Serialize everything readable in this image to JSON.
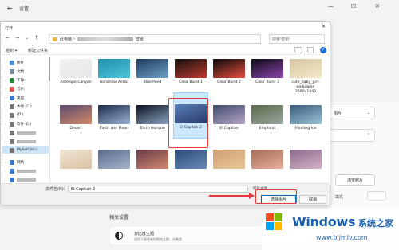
{
  "settings": {
    "back": "←",
    "title": "设置",
    "win_min": "—",
    "win_max": "☐",
    "win_close": "✕",
    "right_card1": "图片",
    "right_card2": "",
    "browse_button": "浏览照片",
    "fit_label": "填充",
    "related_heading": "相关设置",
    "related_item_title": "对比度主题",
    "related_item_sub": "适用于弱视者的颜色主题，光敏度"
  },
  "dialog": {
    "title": "打开",
    "close": "✕",
    "nav": {
      "back": "←",
      "forward": "→",
      "dropdown": "⌄",
      "up": "↑"
    },
    "address": {
      "part1": "此电脑",
      "sep": "›",
      "part_last": "壁纸"
    },
    "search_placeholder": "搜索'壁纸'",
    "toolbar": {
      "organize": "组织 ▾",
      "new_folder": "新建文件夹"
    },
    "sidebar": [
      {
        "label": "图片",
        "chev": "›",
        "color": "#4a90d9"
      },
      {
        "label": "文档",
        "chev": "›",
        "color": "#7a8a99"
      },
      {
        "label": "下载",
        "chev": "›",
        "color": "#2a8a3a"
      },
      {
        "label": "音乐",
        "chev": "›",
        "color": "#d9534f"
      },
      {
        "label": "桌面",
        "chev": "›",
        "color": "#3a78c8"
      },
      {
        "label": "本地 (C:)",
        "chev": "›",
        "color": "#777"
      },
      {
        "label": "(D:)",
        "chev": "›",
        "color": "#777"
      },
      {
        "label": "软件 (E:)",
        "chev": "›",
        "color": "#777"
      },
      {
        "label": "",
        "chev": "›",
        "color": "#777"
      },
      {
        "label": "",
        "chev": "›",
        "color": "#777"
      },
      {
        "label": "MySelf (H:)",
        "chev": "›",
        "color": "#777"
      },
      {
        "label": "网络",
        "chev": "›",
        "color": "#3a78c8"
      },
      {
        "label": "",
        "chev": "›",
        "color": "#3a78c8"
      },
      {
        "label": "",
        "chev": "›",
        "color": "#3a78c8"
      }
    ],
    "files": [
      {
        "name": "Antelope Canyon",
        "c1": "#f2f2f2",
        "c2": "#e6e6e6"
      },
      {
        "name": "Bahamas Aerial",
        "c1": "#1e8fb0",
        "c2": "#4ec6d6"
      },
      {
        "name": "Blue Pond",
        "c1": "#1f3a5a",
        "c2": "#6ea3c9"
      },
      {
        "name": "Color Burst 1",
        "c1": "#111",
        "c2": "#c0392b"
      },
      {
        "name": "Color Burst 2",
        "c1": "#0a0a0a",
        "c2": "#e74c3c"
      },
      {
        "name": "Color Burst 3",
        "c1": "#0a0a14",
        "c2": "#8e44ad"
      },
      {
        "name": "cute_baby_girl-wallpaper-2560x1440",
        "c1": "#d8c8a0",
        "c2": "#f2e7c9"
      },
      {
        "name": "Desert",
        "c1": "#5a4a6e",
        "c2": "#d28a6a"
      },
      {
        "name": "Earth and Moon",
        "c1": "#1a2a4a",
        "c2": "#9bb4d6"
      },
      {
        "name": "Earth Horizon",
        "c1": "#0a0f1c",
        "c2": "#8da4c2"
      },
      {
        "name": "El Capitan 2",
        "c1": "#5a7fb8",
        "c2": "#2a3a6a"
      },
      {
        "name": "El Capitan",
        "c1": "#3a4a6a",
        "c2": "#b9a6c8"
      },
      {
        "name": "Elephant",
        "c1": "#5a6a4a",
        "c2": "#9aa6a0"
      },
      {
        "name": "Floating Ice",
        "c1": "#3a5a7a",
        "c2": "#9ac4d8"
      },
      {
        "name": "",
        "c1": "#f0e6d6",
        "c2": "#d9c0a0"
      },
      {
        "name": "",
        "c1": "#5a6a8a",
        "c2": "#a6b4cc"
      },
      {
        "name": "",
        "c1": "#6a3a4a",
        "c2": "#d08a6a"
      },
      {
        "name": "",
        "c1": "#2a4a7a",
        "c2": "#6a8ab4"
      },
      {
        "name": "",
        "c1": "#d0a070",
        "c2": "#e6c69a"
      },
      {
        "name": "",
        "c1": "#a66a5a",
        "c2": "#e8b09a"
      },
      {
        "name": "",
        "c1": "#8a6a8a",
        "c2": "#d6b0c8"
      }
    ],
    "filename_label": "文件名(N):",
    "filename_value": "El Capitan 2",
    "filetype": "所有文件",
    "open_button": "选择图片",
    "cancel_button": "取消"
  },
  "watermark": {
    "brand": "Windows",
    "cn": "系统之家",
    "url": "www.bjjmlv.com"
  },
  "colors": {
    "accent": "#0067c0",
    "highlight": "#e53935",
    "selected": "#cce8ff"
  }
}
